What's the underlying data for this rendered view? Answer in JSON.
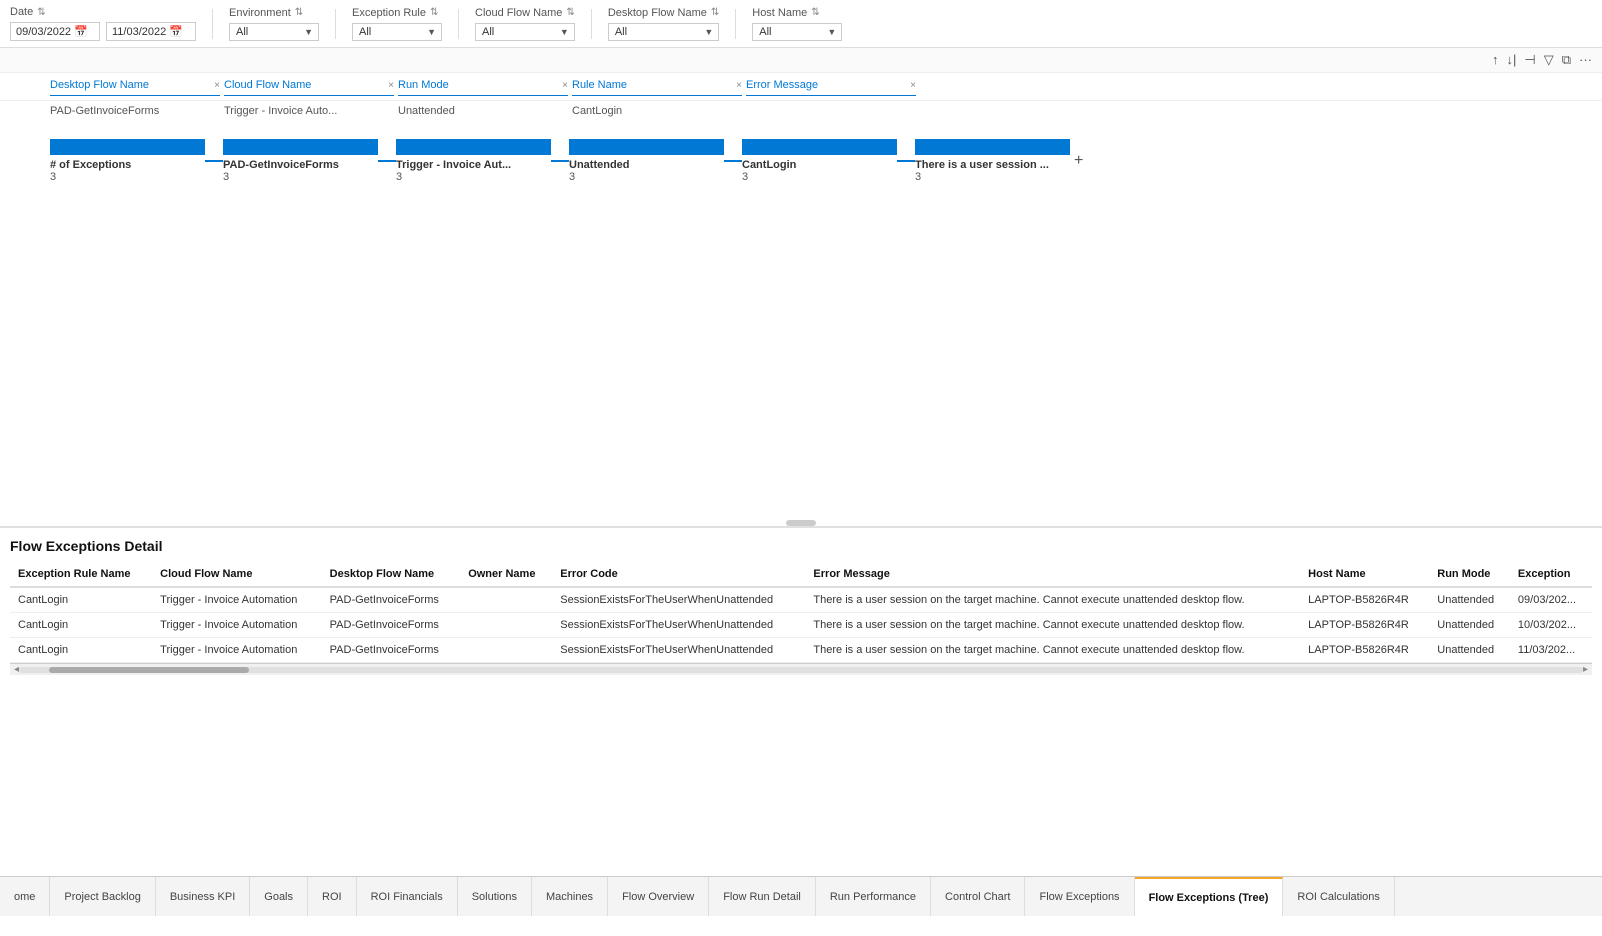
{
  "filters": {
    "date_label": "Date",
    "date_from": "09/03/2022",
    "date_to": "11/03/2022",
    "environment_label": "Environment",
    "environment_value": "All",
    "exception_rule_label": "Exception Rule",
    "exception_rule_value": "All",
    "cloud_flow_label": "Cloud Flow Name",
    "cloud_flow_value": "All",
    "desktop_flow_label": "Desktop Flow Name",
    "desktop_flow_value": "All",
    "host_name_label": "Host Name",
    "host_name_value": "All"
  },
  "tree_columns": [
    {
      "label": "Desktop Flow Name",
      "value": "PAD-GetInvoiceForms"
    },
    {
      "label": "Cloud Flow Name",
      "value": "Trigger - Invoice Auto..."
    },
    {
      "label": "Run Mode",
      "value": "Unattended"
    },
    {
      "label": "Rule Name",
      "value": "CantLogin"
    },
    {
      "label": "Error Message",
      "value": ""
    }
  ],
  "tree_bars": [
    {
      "label": "# of Exceptions",
      "count": "3"
    },
    {
      "label": "PAD-GetInvoiceForms",
      "count": "3"
    },
    {
      "label": "Trigger - Invoice Aut...",
      "count": "3"
    },
    {
      "label": "Unattended",
      "count": "3"
    },
    {
      "label": "CantLogin",
      "count": "3"
    },
    {
      "label": "There is a user session ...",
      "count": "3"
    }
  ],
  "section_title": "Flow Exceptions Detail",
  "table_headers": [
    "Exception Rule Name",
    "Cloud Flow Name",
    "Desktop Flow Name",
    "Owner Name",
    "Error Code",
    "Error Message",
    "Host Name",
    "Run Mode",
    "Exception"
  ],
  "table_rows": [
    {
      "exception_rule": "CantLogin",
      "cloud_flow": "Trigger - Invoice Automation",
      "desktop_flow": "PAD-GetInvoiceForms",
      "owner": "",
      "error_code": "SessionExistsForTheUserWhenUnattended",
      "error_message": "There is a user session on the target machine. Cannot execute unattended desktop flow.",
      "host_name": "LAPTOP-B5826R4R",
      "run_mode": "Unattended",
      "exception": "09/03/202..."
    },
    {
      "exception_rule": "CantLogin",
      "cloud_flow": "Trigger - Invoice Automation",
      "desktop_flow": "PAD-GetInvoiceForms",
      "owner": "",
      "error_code": "SessionExistsForTheUserWhenUnattended",
      "error_message": "There is a user session on the target machine. Cannot execute unattended desktop flow.",
      "host_name": "LAPTOP-B5826R4R",
      "run_mode": "Unattended",
      "exception": "10/03/202..."
    },
    {
      "exception_rule": "CantLogin",
      "cloud_flow": "Trigger - Invoice Automation",
      "desktop_flow": "PAD-GetInvoiceForms",
      "owner": "",
      "error_code": "SessionExistsForTheUserWhenUnattended",
      "error_message": "There is a user session on the target machine. Cannot execute unattended desktop flow.",
      "host_name": "LAPTOP-B5826R4R",
      "run_mode": "Unattended",
      "exception": "11/03/202..."
    }
  ],
  "tabs": [
    {
      "label": "ome",
      "active": false
    },
    {
      "label": "Project Backlog",
      "active": false
    },
    {
      "label": "Business KPI",
      "active": false
    },
    {
      "label": "Goals",
      "active": false
    },
    {
      "label": "ROI",
      "active": false
    },
    {
      "label": "ROI Financials",
      "active": false
    },
    {
      "label": "Solutions",
      "active": false
    },
    {
      "label": "Machines",
      "active": false
    },
    {
      "label": "Flow Overview",
      "active": false
    },
    {
      "label": "Flow Run Detail",
      "active": false
    },
    {
      "label": "Run Performance",
      "active": false
    },
    {
      "label": "Control Chart",
      "active": false
    },
    {
      "label": "Flow Exceptions",
      "active": false
    },
    {
      "label": "Flow Exceptions (Tree)",
      "active": true
    },
    {
      "label": "ROI Calculations",
      "active": false
    }
  ]
}
